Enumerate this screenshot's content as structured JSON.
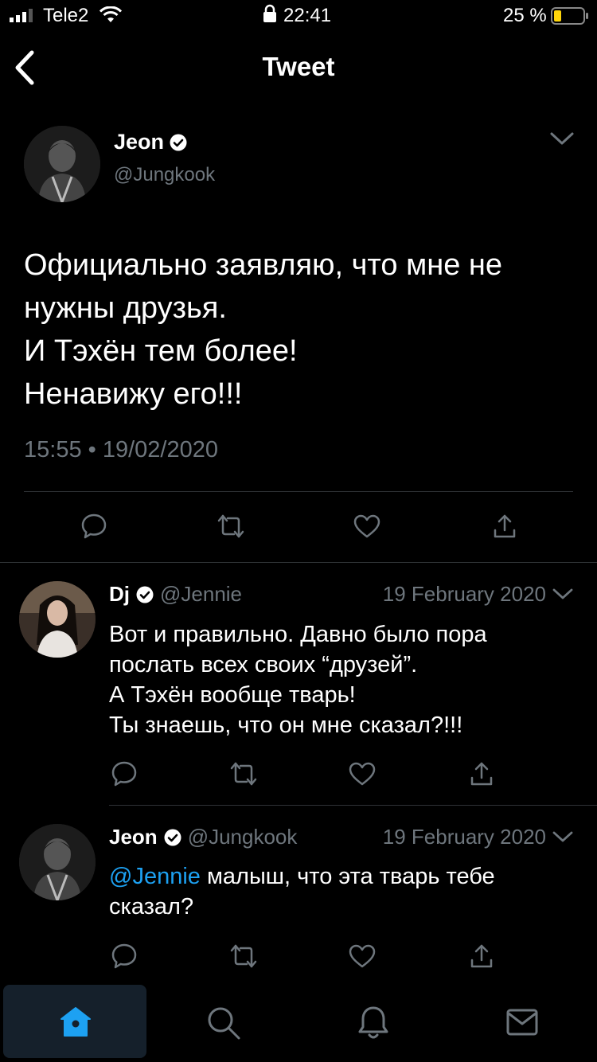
{
  "status_bar": {
    "carrier": "Tele2",
    "time": "22:41",
    "battery": "25 %"
  },
  "header": {
    "title": "Tweet"
  },
  "main_tweet": {
    "name": "Jeon",
    "handle": "@Jungkook",
    "lines": [
      "Официально заявляю, что мне не",
      "нужны друзья.",
      "И Тэхён тем более!",
      "Ненавижу его!!!"
    ],
    "timestamp": "15:55 • 19/02/2020"
  },
  "replies": [
    {
      "name": "Dj",
      "handle": "@Jennie",
      "date": "19 February 2020",
      "lines": [
        "Вот и правильно. Давно было пора",
        "послать всех своих “друзей”.",
        "А Тэхён вообще тварь!",
        "Ты знаешь, что он мне сказал?!!!"
      ]
    },
    {
      "name": "Jeon",
      "handle": "@Jungkook",
      "date": "19 February 2020",
      "mention": "@Jennie",
      "lines": [
        " малыш, что эта тварь тебе",
        "сказал?"
      ]
    }
  ],
  "icons": {
    "reply": "reply-icon",
    "retweet": "retweet-icon",
    "like": "like-icon",
    "share": "share-icon",
    "tabs": [
      "home-icon",
      "search-icon",
      "notifications-icon",
      "messages-icon"
    ]
  },
  "colors": {
    "background": "#000000",
    "accent": "#1da1f2",
    "muted": "#6e767d",
    "divider": "#2f3336",
    "battery_low": "#ffd60a"
  }
}
